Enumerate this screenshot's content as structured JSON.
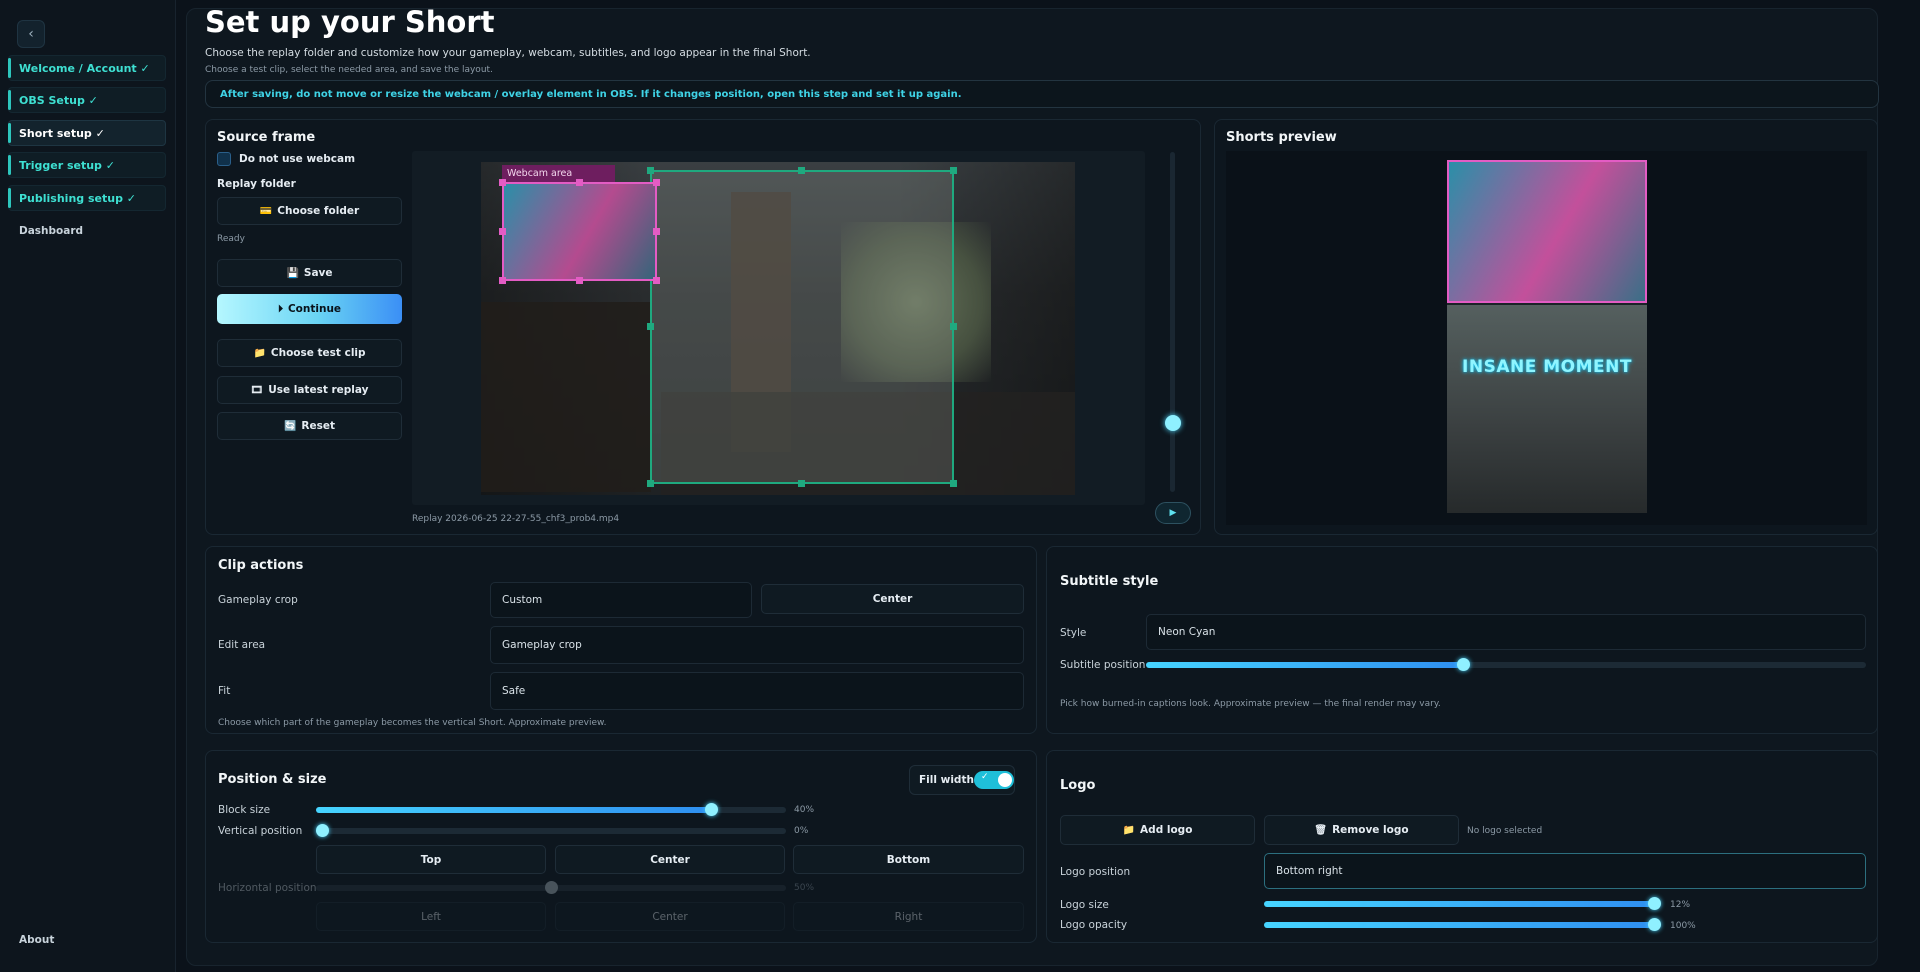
{
  "sidebar": {
    "back_icon": "‹",
    "items": [
      {
        "label": "Welcome / Account ✓"
      },
      {
        "label": "OBS Setup ✓"
      },
      {
        "label": "Short setup ✓"
      },
      {
        "label": "Trigger setup ✓"
      },
      {
        "label": "Publishing setup ✓"
      }
    ],
    "dashboard": "Dashboard",
    "about": "About"
  },
  "header": {
    "title": "Set up your Short",
    "subtitle": "Choose the replay folder and customize how your gameplay, webcam, subtitles, and logo appear in the final Short.",
    "hint": "Choose a test clip, select the needed area, and save the layout.",
    "warning": "After saving, do not move or resize the webcam / overlay element in OBS. If it changes position, open this step and set it up again."
  },
  "source": {
    "title": "Source frame",
    "webcam_toggle_label": "Do not use webcam",
    "replay_folder_label": "Replay folder",
    "choose_folder": "Choose folder",
    "status": "Ready",
    "save": "Save",
    "continue": "Continue",
    "choose_test_clip": "Choose test clip",
    "use_latest_replay": "Use latest replay",
    "reset": "Reset",
    "webcam_area_label": "Webcam area",
    "filename": "Replay 2026-06-25 22-27-55_chf3_prob4.mp4",
    "play_icon": "▶"
  },
  "preview": {
    "title": "Shorts preview",
    "subtitle_text": "INSANE MOMENT"
  },
  "clip_actions": {
    "title": "Clip actions",
    "gameplay_crop_label": "Gameplay crop",
    "gameplay_crop_value": "Custom",
    "center_button": "Center",
    "edit_area_label": "Edit area",
    "edit_area_value": "Gameplay crop",
    "fit_label": "Fit",
    "fit_value": "Safe",
    "note": "Choose which part of the gameplay becomes the vertical Short. Approximate preview."
  },
  "subtitle_style": {
    "title": "Subtitle style",
    "style_label": "Style",
    "style_value": "Neon Cyan",
    "position_label": "Subtitle position",
    "position_value": 0.44,
    "note": "Pick how burned-in captions look. Approximate preview — the final render may vary."
  },
  "position_size": {
    "title": "Position & size",
    "fill_width_label": "Fill width",
    "fill_width_on": true,
    "block_size_label": "Block size",
    "block_size_text": "40%",
    "block_size_value": 0.84,
    "vertical_label": "Vertical position",
    "vertical_text": "0%",
    "vertical_value": 0.0,
    "top": "Top",
    "center": "Center",
    "bottom": "Bottom",
    "horizontal_label": "Horizontal position",
    "horizontal_text": "50%",
    "horizontal_value": 0.5,
    "left": "Left",
    "h_center": "Center",
    "right": "Right"
  },
  "logo": {
    "title": "Logo",
    "add_logo": "Add logo",
    "remove_logo": "Remove logo",
    "status": "No logo selected",
    "position_label": "Logo position",
    "position_value": "Bottom right",
    "size_label": "Logo size",
    "size_text": "12%",
    "size_value": 1.0,
    "opacity_label": "Logo opacity",
    "opacity_text": "100%",
    "opacity_value": 1.0
  },
  "colors": {
    "accent": "#3ee0d2",
    "webcam_box": "#e35cc4",
    "crop_box": "#1fa97f"
  }
}
